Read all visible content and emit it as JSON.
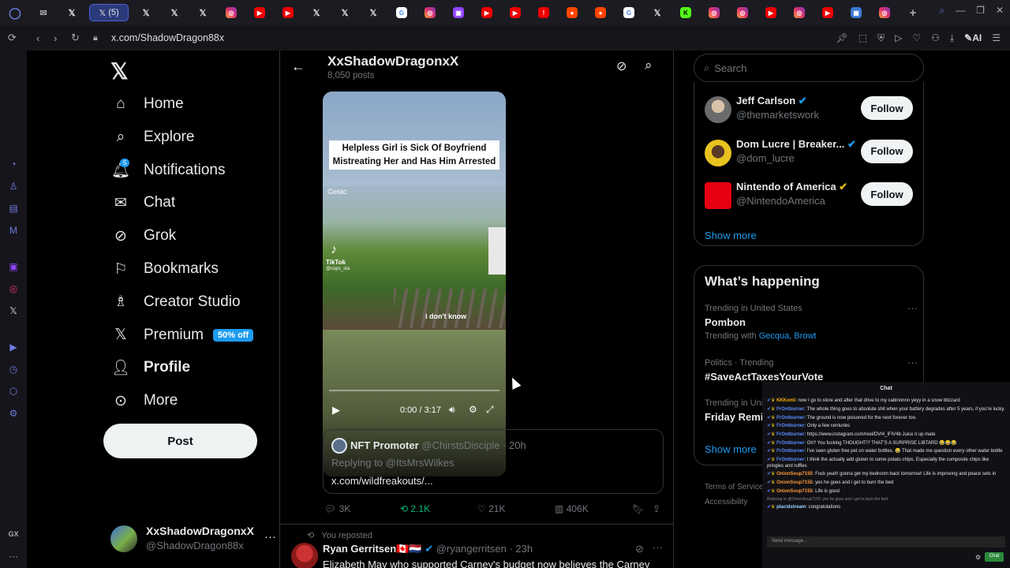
{
  "browser": {
    "active_tab_label": "(5)",
    "url": "x.com/ShadowDragon88x",
    "ai_label": "AI",
    "tab_icons": [
      "mail-icon",
      "x-icon",
      "x-icon",
      "x-icon",
      "instagram-icon",
      "youtube-icon",
      "youtube-icon",
      "x-icon",
      "x-icon",
      "x-icon",
      "google-icon",
      "instagram-icon",
      "twitch-icon",
      "youtube-icon",
      "youtube-icon",
      "alert-icon",
      "reddit-icon",
      "reddit-icon",
      "google-icon",
      "x-icon",
      "kick-icon",
      "instagram-icon",
      "instagram-icon",
      "youtube-icon",
      "instagram-icon",
      "youtube-icon",
      "app-icon",
      "instagram-icon"
    ],
    "gx_label": "GX"
  },
  "nav": {
    "items": [
      {
        "label": "Home",
        "icon": "home-icon"
      },
      {
        "label": "Explore",
        "icon": "search-icon"
      },
      {
        "label": "Notifications",
        "icon": "bell-icon",
        "badge": "5"
      },
      {
        "label": "Chat",
        "icon": "mail-icon"
      },
      {
        "label": "Grok",
        "icon": "grok-icon"
      },
      {
        "label": "Bookmarks",
        "icon": "bookmark-icon"
      },
      {
        "label": "Creator Studio",
        "icon": "creator-icon"
      },
      {
        "label": "Premium",
        "icon": "x-icon",
        "badge": "50% off"
      },
      {
        "label": "Profile",
        "icon": "profile-icon"
      },
      {
        "label": "More",
        "icon": "more-icon"
      }
    ],
    "post_label": "Post",
    "account": {
      "name": "XxShadowDragonxX",
      "handle": "@ShadowDragon88x"
    }
  },
  "profile_header": {
    "name": "XxShadowDragonxX",
    "posts": "8,050 posts"
  },
  "video": {
    "caption_line1": "Helpless Girl is Sick Of Boyfriend",
    "caption_line2": "Mistreating Her and Has Him Arrested",
    "watermark": "Getac",
    "tiktok": "TikTok",
    "tiktok_handle": "@cops_sta",
    "subtitle": "i don't know",
    "time": "0:00 / 3:17",
    "progress": 0
  },
  "quoted": {
    "name": "NFT Promoter",
    "handle": "@ChirstsDisciple",
    "time": "· 20h",
    "replying": "Replying to @ItsMrsWilkes",
    "link": "x.com/wildfreakouts/..."
  },
  "actions": {
    "replies": "3K",
    "reposts": "2.1K",
    "likes": "21K",
    "views": "406K"
  },
  "next_post": {
    "reposted_label": "You reposted",
    "name": "Ryan Gerritsen🇨🇦🇳🇱",
    "handle": "@ryangerritsen",
    "time": "· 23h",
    "text": "Elizabeth May who supported Carney's budget now believes the Carney"
  },
  "search": {
    "placeholder": "Search"
  },
  "who_to_follow": {
    "accounts": [
      {
        "name": "Jeff Carlson",
        "handle": "@themarketswork",
        "verified": "blue"
      },
      {
        "name": "Dom Lucre | Breaker...",
        "handle": "@dom_lucre",
        "verified": "blue"
      },
      {
        "name": "Nintendo of America",
        "handle": "@NintendoAmerica",
        "verified": "gold"
      }
    ],
    "follow_label": "Follow",
    "show_more": "Show more"
  },
  "happening": {
    "title": "What’s happening",
    "trends": [
      {
        "context": "Trending in United States",
        "topic": "Pombon",
        "extra_prefix": "Trending with",
        "extra": "Gecqua, Browt"
      },
      {
        "context": "Politics · Trending",
        "topic": "#SaveActTaxesYourVote"
      },
      {
        "context": "Trending in Uni",
        "topic": "Friday Remi"
      }
    ],
    "show_more": "Show more"
  },
  "footer": {
    "terms": "Terms of Service",
    "accessibility": "Accessibility"
  },
  "chat": {
    "title": "Chat",
    "messages": [
      {
        "user": "KKKonti",
        "color": "#ffb000",
        "text": "now I go to store and after that drive to my cabinnnnn yeyy in a snow blizzard"
      },
      {
        "user": "FrOntburner",
        "color": "#5b8dff",
        "text": "The whole thing goes to absolute shit when your battery degrades after 5 years, if you're lucky."
      },
      {
        "user": "FrOntburner",
        "color": "#5b8dff",
        "text": "The ground is now poisoned for the next forever too."
      },
      {
        "user": "FrOntburner",
        "color": "#5b8dff",
        "text": "Only a few centuries"
      },
      {
        "user": "FrOntburner",
        "color": "#5b8dff",
        "text": "https://www.instagram.com/reel/DVI4_lFIV4b Juice it up mate"
      },
      {
        "user": "FrOntburner",
        "color": "#5b8dff",
        "text": "Oh? You fucking THOUGHT!? THAT'S A SURPRISE LIBTARD 😂😂😂"
      },
      {
        "user": "FrOntburner",
        "color": "#5b8dff",
        "text": "I've seen gluten free pet on water bottles. 😂 That made me question every other water bottle"
      },
      {
        "user": "FrOntburner",
        "color": "#5b8dff",
        "text": "I think the actually add gluten to some potato chips. Especially the composite chips like pringles and ruffles"
      },
      {
        "user": "OnionSoup7155",
        "color": "#ff9a3c",
        "text": "Fuck yeah! gonna get my bedroom back tomorrow! Life is improving and peace sets in"
      },
      {
        "user": "OnionSoup7155",
        "color": "#ff9a3c",
        "text": "yes he goes and i get to burn the bed"
      },
      {
        "user": "OnionSoup7155",
        "color": "#ff9a3c",
        "text": "Life is good"
      },
      {
        "user": "placidstream",
        "color": "#9ad7ff",
        "text": "congratulations",
        "reply": "Replying to @OnionSoup7155: yes he goes and i get to burn the bed"
      }
    ],
    "input_placeholder": "Send message...",
    "send_label": "Chat"
  }
}
